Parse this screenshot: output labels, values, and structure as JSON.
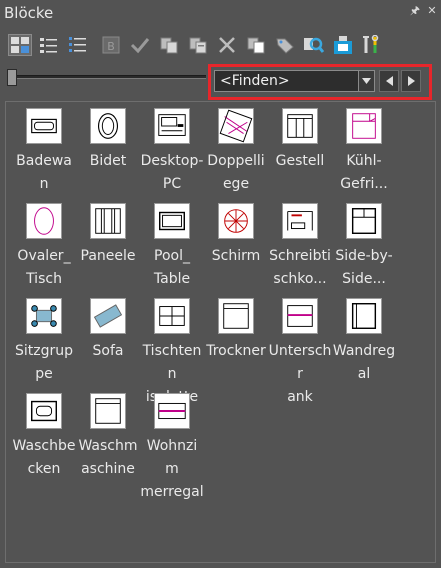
{
  "window": {
    "title": "Blöcke",
    "pin_glyph": "🖈",
    "close_glyph": "✕"
  },
  "toolbar": {
    "icons": [
      "thumbnail-view-icon",
      "list-view-icon",
      "detail-view-icon",
      "block-icon",
      "check-icon",
      "copy-icon",
      "paste-icon",
      "delete-icon",
      "duplicate-icon",
      "tag-icon",
      "find-icon",
      "insert-icon",
      "tools-icon"
    ]
  },
  "search": {
    "value": "<Finden>"
  },
  "colors": {
    "highlight": "#e8262b",
    "line": "#000000",
    "accent": "#c0008a"
  },
  "blocks": [
    {
      "label": "Badewan\nne",
      "icon": "bathtub-icon"
    },
    {
      "label": "Bidet",
      "icon": "bidet-icon"
    },
    {
      "label": "Desktop-\nPC",
      "icon": "desktop-pc-icon"
    },
    {
      "label": "Doppelli\nege",
      "icon": "double-bed-icon"
    },
    {
      "label": "Gestell",
      "icon": "rack-icon"
    },
    {
      "label": "Kühl-\nGefri...",
      "icon": "fridge-freezer-icon"
    },
    {
      "label": "Ovaler_\nTisch",
      "icon": "oval-table-icon"
    },
    {
      "label": "Paneele",
      "icon": "panels-icon"
    },
    {
      "label": "Pool_\nTable",
      "icon": "pool-table-icon"
    },
    {
      "label": "Schirm",
      "icon": "umbrella-icon"
    },
    {
      "label": "Schreibti\nschko...",
      "icon": "desk-icon"
    },
    {
      "label": "Side-by-\nSide...",
      "icon": "side-by-side-icon"
    },
    {
      "label": "Sitzgrup\npe",
      "icon": "seating-group-icon"
    },
    {
      "label": "Sofa",
      "icon": "sofa-icon"
    },
    {
      "label": "Tischtenn\nisplatte",
      "icon": "table-tennis-icon"
    },
    {
      "label": "Trockner",
      "icon": "dryer-icon"
    },
    {
      "label": "Unterschr\nank",
      "icon": "base-cabinet-icon"
    },
    {
      "label": "Wandreg\nal",
      "icon": "wall-shelf-icon"
    },
    {
      "label": "Waschbe\ncken",
      "icon": "washbasin-icon"
    },
    {
      "label": "Waschm\naschine",
      "icon": "washing-machine-icon"
    },
    {
      "label": "Wohnzim\nmerregal",
      "icon": "living-room-shelf-icon"
    }
  ]
}
